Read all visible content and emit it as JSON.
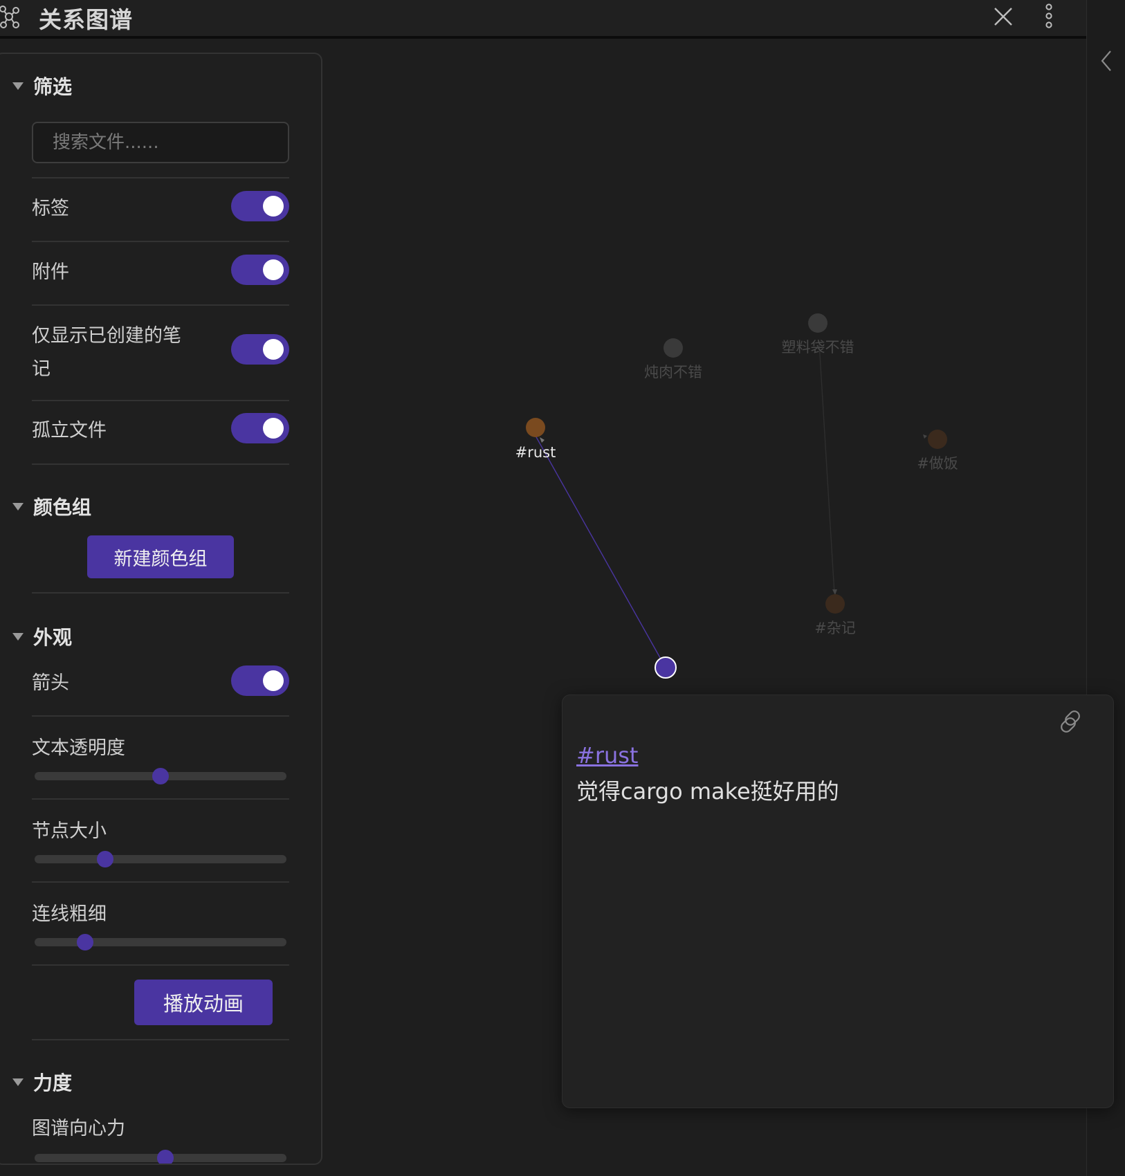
{
  "header": {
    "title": "关系图谱"
  },
  "filters": {
    "heading": "筛选",
    "search_placeholder": "搜索文件......",
    "toggles": [
      {
        "label": "标签",
        "on": true
      },
      {
        "label": "附件",
        "on": true
      },
      {
        "label_line1": "仅显示已创建的笔",
        "label_line2": "记",
        "on": true
      },
      {
        "label": "孤立文件",
        "on": true
      }
    ]
  },
  "groups": {
    "heading": "颜色组",
    "new_group_label": "新建颜色组"
  },
  "display": {
    "heading": "外观",
    "arrows_label": "箭头",
    "arrows_on": true,
    "text_opacity_label": "文本透明度",
    "text_opacity_value": 0.5,
    "node_size_label": "节点大小",
    "node_size_value": 0.28,
    "link_thickness_label": "连线粗细",
    "link_thickness_value": 0.2,
    "animate_label": "播放动画"
  },
  "forces": {
    "heading": "力度",
    "center_force_label": "图谱向心力",
    "center_force_value": 0.52
  },
  "graph": {
    "nodes": [
      {
        "id": "rust",
        "label": "#rust",
        "kind": "tag",
        "highlighted": true
      },
      {
        "id": "stew",
        "label": "炖肉不错",
        "kind": "note",
        "highlighted": false
      },
      {
        "id": "bag",
        "label": "塑料袋不错",
        "kind": "note",
        "highlighted": false
      },
      {
        "id": "cook",
        "label": "#做饭",
        "kind": "tag",
        "highlighted": false
      },
      {
        "id": "misc",
        "label": "#杂记",
        "kind": "tag",
        "highlighted": false
      },
      {
        "id": "note",
        "label": "",
        "kind": "note",
        "highlighted": true,
        "hovered": true
      }
    ],
    "links": [
      {
        "from": "note",
        "to": "rust",
        "highlighted": true
      },
      {
        "from": "bag",
        "to": "misc",
        "highlighted": false
      }
    ],
    "colors": {
      "accent": "#4a35a1",
      "tag_node": "#7a4a1f",
      "note_node": "#3a3a3a"
    }
  },
  "preview": {
    "tag": "#rust",
    "text": "觉得cargo make挺好用的"
  }
}
